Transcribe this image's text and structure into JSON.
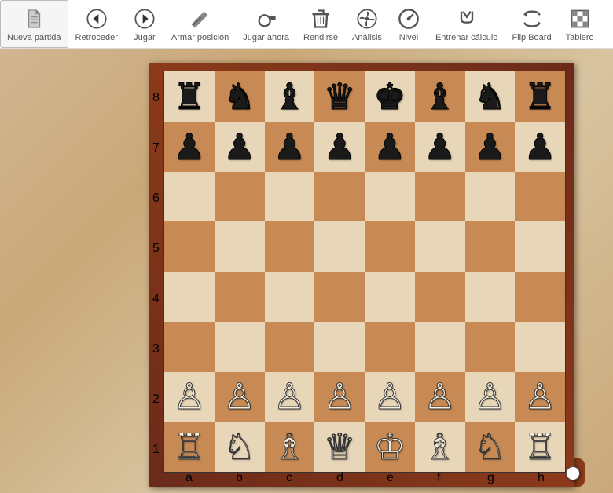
{
  "toolbar": {
    "items": [
      {
        "id": "new-game",
        "label": "Nueva partida",
        "icon": "file",
        "selected": true
      },
      {
        "id": "back",
        "label": "Retroceder",
        "icon": "arrow-left",
        "selected": false
      },
      {
        "id": "play",
        "label": "Jugar",
        "icon": "arrow-right",
        "selected": false
      },
      {
        "id": "setup",
        "label": "Armar posición",
        "icon": "saw",
        "selected": false
      },
      {
        "id": "play-now",
        "label": "Jugar ahora",
        "icon": "whistle",
        "selected": false
      },
      {
        "id": "resign",
        "label": "Rendirse",
        "icon": "trash",
        "selected": false
      },
      {
        "id": "analysis",
        "label": "Análisis",
        "icon": "fan",
        "selected": false
      },
      {
        "id": "level",
        "label": "Nivel",
        "icon": "gauge",
        "selected": false
      },
      {
        "id": "train",
        "label": "Entrenar cálculo",
        "icon": "gripper",
        "selected": false
      },
      {
        "id": "flip",
        "label": "Flip Board",
        "icon": "flip",
        "selected": false
      },
      {
        "id": "board",
        "label": "Tablero",
        "icon": "board",
        "selected": false
      }
    ]
  },
  "board": {
    "files": [
      "a",
      "b",
      "c",
      "d",
      "e",
      "f",
      "g",
      "h"
    ],
    "ranks": [
      "8",
      "7",
      "6",
      "5",
      "4",
      "3",
      "2",
      "1"
    ],
    "light_color": "#e8d6b8",
    "dark_color": "#c88a54",
    "frame_color": "#7a2f18",
    "label_color": "#e8c040",
    "turn": "white",
    "position": {
      "a8": "br",
      "b8": "bn",
      "c8": "bb",
      "d8": "bq",
      "e8": "bk",
      "f8": "bb",
      "g8": "bn",
      "h8": "br",
      "a7": "bp",
      "b7": "bp",
      "c7": "bp",
      "d7": "bp",
      "e7": "bp",
      "f7": "bp",
      "g7": "bp",
      "h7": "bp",
      "a2": "wp",
      "b2": "wp",
      "c2": "wp",
      "d2": "wp",
      "e2": "wp",
      "f2": "wp",
      "g2": "wp",
      "h2": "wp",
      "a1": "wr",
      "b1": "wn",
      "c1": "wb",
      "d1": "wq",
      "e1": "wk",
      "f1": "wb",
      "g1": "wn",
      "h1": "wr"
    }
  },
  "piece_glyphs": {
    "wk": "♔",
    "wq": "♕",
    "wr": "♖",
    "wb": "♗",
    "wn": "♘",
    "wp": "♙",
    "bk": "♚",
    "bq": "♛",
    "br": "♜",
    "bb": "♝",
    "bn": "♞",
    "bp": "♟"
  }
}
